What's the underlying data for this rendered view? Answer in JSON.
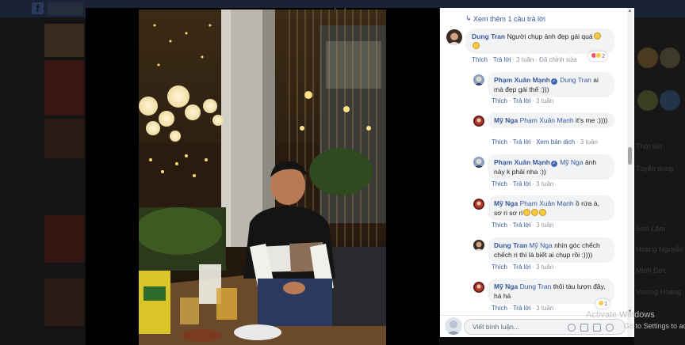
{
  "viewer": {
    "see_more": "Xem thêm 1 câu trả lời"
  },
  "comments": [
    {
      "name": "Dung Tran",
      "verified": false,
      "mention": "",
      "text": "Người chụp ảnh đẹp gái quá",
      "emoji_count": 2,
      "actions": [
        "Thích",
        "Trả lời"
      ],
      "time": "3 tuần",
      "extra": "Đã chỉnh sửa",
      "reactions": "2",
      "reply": false
    },
    {
      "name": "Phạm Xuân Mạnh",
      "verified": true,
      "mention": "Dung Tran",
      "text": "ai mà đẹp gái thế :)))",
      "actions": [
        "Thích",
        "Trả lời"
      ],
      "time": "3 tuần",
      "reply": true
    },
    {
      "name": "Mỹ Nga",
      "verified": false,
      "mention": "Phạm Xuân Mạnh",
      "text": "it's me :))))",
      "actions": [
        "Thích",
        "Trả lời",
        "Xem bản dịch"
      ],
      "time": "3 tuần",
      "reply": true
    },
    {
      "name": "Phạm Xuân Mạnh",
      "verified": true,
      "mention": "Mỹ Nga",
      "text": "ảnh này k phải nha :))",
      "actions": [
        "Thích",
        "Trả lời"
      ],
      "time": "3 tuần",
      "reply": true
    },
    {
      "name": "Mỹ Nga",
      "verified": false,
      "mention": "Phạm Xuân Mạnh",
      "text": "ồ rứa à, sơ ri sơ ri",
      "emoji_count": 3,
      "actions": [
        "Thích",
        "Trả lời"
      ],
      "time": "3 tuần",
      "reply": true
    },
    {
      "name": "Dung Tran",
      "verified": false,
      "mention": "Mỹ Nga",
      "text": "nhìn góc chếch chếch ri thì là biết ai chụp rồi :))))",
      "actions": [
        "Thích",
        "Trả lời"
      ],
      "time": "3 tuần",
      "reply": true
    },
    {
      "name": "Mỹ Nga",
      "verified": false,
      "mention": "Dung Tran",
      "text": "thôi tàu lượn đây, há há",
      "actions": [
        "Thích",
        "Trả lời"
      ],
      "time": "3 tuần",
      "reactions": "1",
      "reply": true
    }
  ],
  "composer": {
    "placeholder": "Viết bình luận..."
  },
  "watermark": {
    "line1": "Activate Windows",
    "line2": "Go to Settings to activate Windows."
  },
  "colors": {
    "link": "#385898",
    "bubble": "#f2f3f5",
    "verified": "#4267b2"
  }
}
